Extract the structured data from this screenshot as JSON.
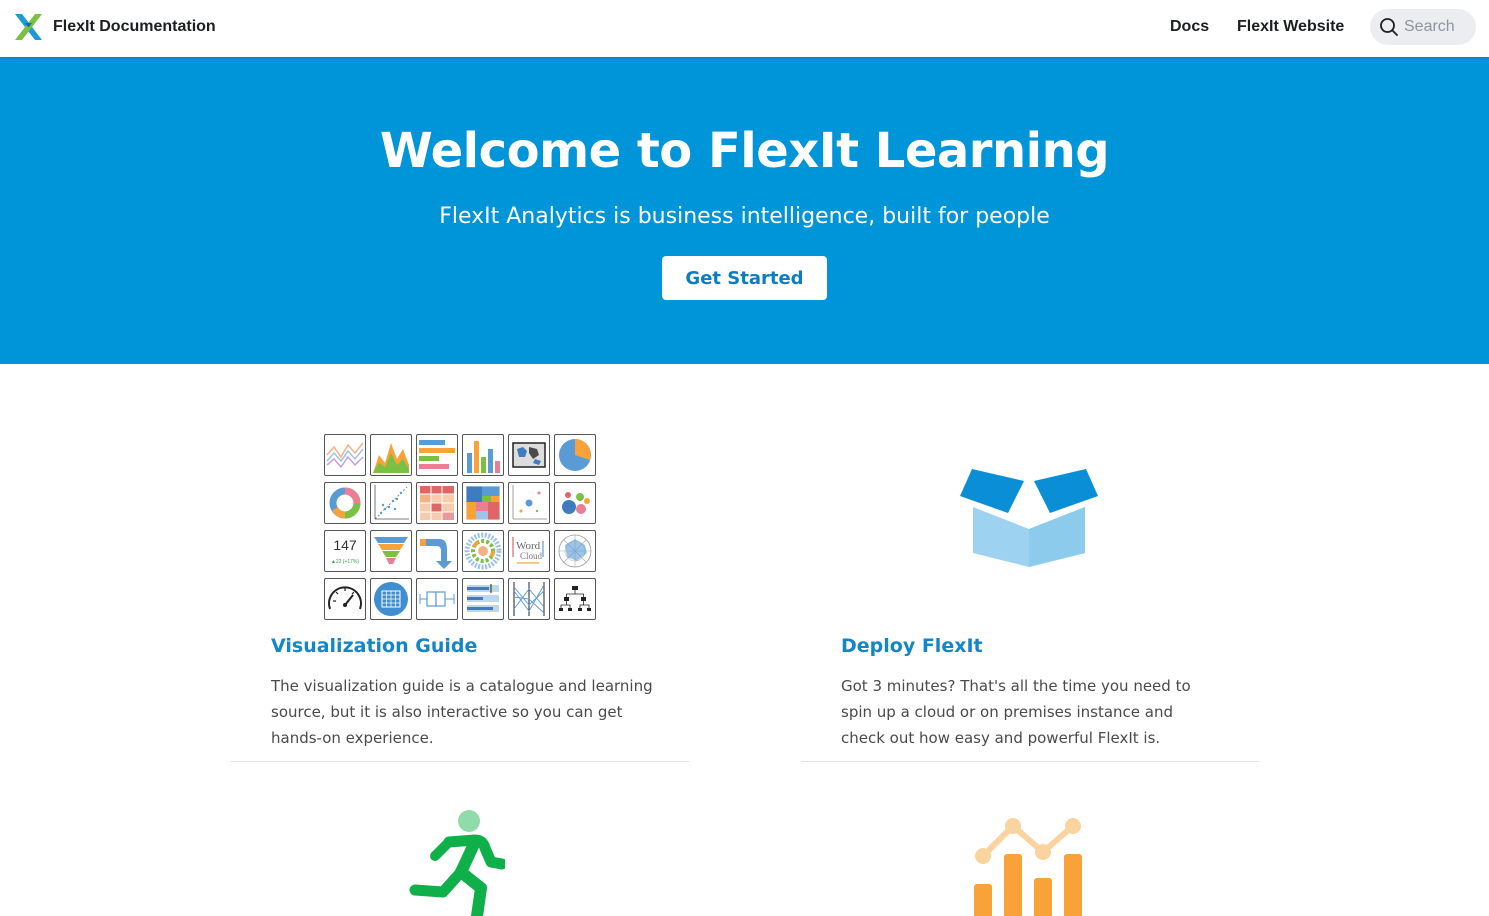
{
  "navbar": {
    "brand_title": "FlexIt Documentation",
    "links": [
      "Docs",
      "FlexIt Website"
    ],
    "search_placeholder": "Search"
  },
  "hero": {
    "title": "Welcome to FlexIt Learning",
    "subtitle": "FlexIt Analytics is business intelligence, built for people",
    "cta_label": "Get Started"
  },
  "features": [
    {
      "title": "Visualization Guide",
      "description": "The visualization guide is a catalogue and learning source, but it is also interactive so you can get hands-on experience."
    },
    {
      "title": "Deploy FlexIt",
      "description": "Got 3 minutes? That's all the time you need to spin up a cloud or on premises instance and check out how easy and powerful FlexIt is."
    }
  ],
  "chart_tiles": {
    "kpi_value": "147",
    "kpi_delta": "▲22 (+17%)",
    "wordcloud_text": [
      "Word",
      "Cloud"
    ]
  },
  "colors": {
    "brand_blue": "#0094d8",
    "link_blue": "#1286c6",
    "icon_green": "#0fb04a",
    "icon_orange": "#f9a23a"
  }
}
